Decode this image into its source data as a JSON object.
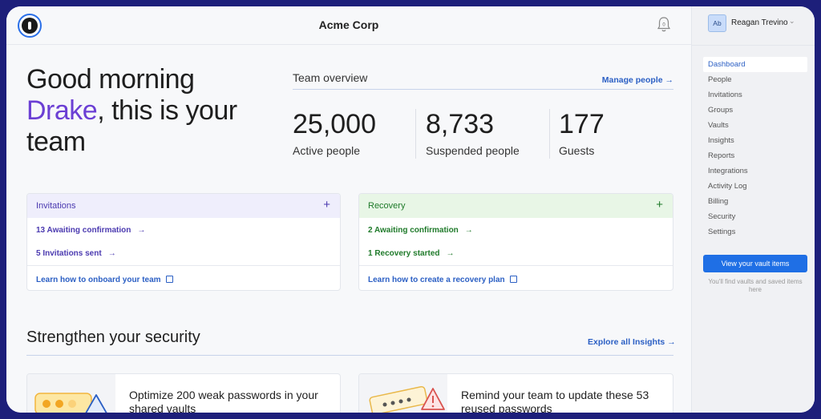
{
  "header": {
    "title": "Acme Corp",
    "notification_count": "0"
  },
  "greeting": {
    "line1": "Good morning",
    "name": "Drake",
    "rest": ", this is your team"
  },
  "overview": {
    "title": "Team overview",
    "manage_link": "Manage people →",
    "stats": [
      {
        "value": "25,000",
        "label": "Active people"
      },
      {
        "value": "8,733",
        "label": "Suspended people"
      },
      {
        "value": "177",
        "label": "Guests"
      }
    ]
  },
  "invitations": {
    "title": "Invitations",
    "add": "+",
    "rows": [
      "13 Awaiting confirmation",
      "5 Invitations sent"
    ],
    "learn": "Learn how to onboard your team",
    "colors": {
      "header_bg": "#efeefc",
      "text": "#4b3ab0"
    }
  },
  "recovery": {
    "title": "Recovery",
    "add": "+",
    "rows": [
      "2 Awaiting confirmation",
      "1 Recovery started"
    ],
    "learn": "Learn how to create a recovery plan",
    "colors": {
      "header_bg": "#e8f6e6",
      "text": "#1f7a2a"
    }
  },
  "security": {
    "title": "Strengthen your security",
    "explore_link": "Explore all Insights →",
    "cards": [
      {
        "text": "Optimize 200 weak passwords in your shared vaults"
      },
      {
        "text": "Remind your team to update these 53 reused passwords"
      }
    ]
  },
  "sidebar": {
    "avatar_initials": "Ab",
    "user_name": "Reagan Trevino",
    "items": [
      {
        "label": "Dashboard",
        "active": true
      },
      {
        "label": "People"
      },
      {
        "label": "Invitations"
      },
      {
        "label": "Groups"
      },
      {
        "label": "Vaults"
      },
      {
        "label": "Insights"
      },
      {
        "label": "Reports"
      },
      {
        "label": "Integrations"
      },
      {
        "label": "Activity Log"
      },
      {
        "label": "Billing"
      },
      {
        "label": "Security"
      },
      {
        "label": "Settings"
      }
    ],
    "vault_button": "View your vault items",
    "vault_note": "You'll find vaults and saved items here"
  },
  "colors": {
    "accent": "#2b5fc4",
    "brand_purple": "#6b3fd4",
    "frame": "#1d1f7a",
    "primary_button": "#1f6fe5"
  }
}
